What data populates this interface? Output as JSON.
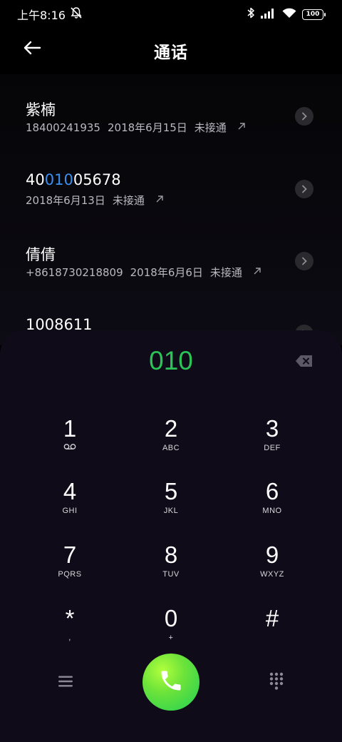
{
  "status_bar": {
    "time": "上午8:16",
    "battery": "100"
  },
  "header": {
    "title": "通话"
  },
  "calls": [
    {
      "name_parts": [
        "紫楠",
        "",
        ""
      ],
      "number": "18400241935",
      "date": "2018年6月15日",
      "status": "未接通"
    },
    {
      "name_parts": [
        "40",
        "010",
        "05678"
      ],
      "number": "",
      "date": "2018年6月13日",
      "status": "未接通"
    },
    {
      "name_parts": [
        "倩倩",
        "",
        ""
      ],
      "number": "+8618730218809",
      "date": "2018年6月6日",
      "status": "未接通"
    },
    {
      "name_parts": [
        "1008611",
        "",
        ""
      ],
      "number": "",
      "date": "",
      "status": ""
    }
  ],
  "dialer": {
    "input": "010",
    "number_color": "#2bc457",
    "highlight_color": "#3b8ff0",
    "keys": [
      {
        "digit": "1",
        "sub": ""
      },
      {
        "digit": "2",
        "sub": "ABC"
      },
      {
        "digit": "3",
        "sub": "DEF"
      },
      {
        "digit": "4",
        "sub": "GHI"
      },
      {
        "digit": "5",
        "sub": "JKL"
      },
      {
        "digit": "6",
        "sub": "MNO"
      },
      {
        "digit": "7",
        "sub": "PQRS"
      },
      {
        "digit": "8",
        "sub": "TUV"
      },
      {
        "digit": "9",
        "sub": "WXYZ"
      },
      {
        "digit": "*",
        "sub": ","
      },
      {
        "digit": "0",
        "sub": "+"
      },
      {
        "digit": "#",
        "sub": ""
      }
    ]
  },
  "icons": {
    "back": "arrow-left-icon",
    "muted": "bell-off-icon",
    "bluetooth": "bluetooth-icon",
    "signal": "signal-icon",
    "wifi": "wifi-icon",
    "voicemail": "voicemail-icon",
    "delete": "backspace-icon",
    "menu": "menu-icon",
    "call": "phone-icon",
    "keypad": "dialpad-icon"
  }
}
